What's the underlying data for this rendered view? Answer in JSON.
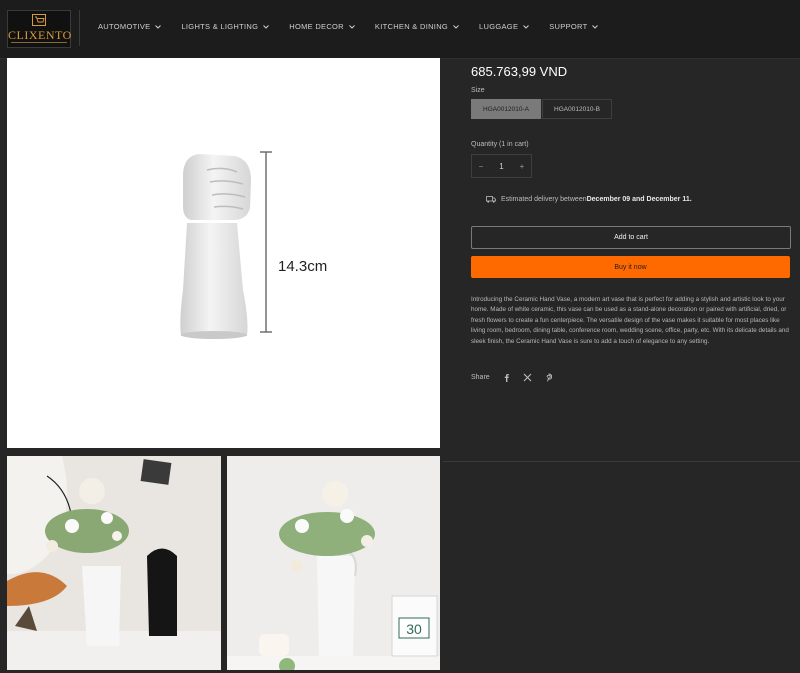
{
  "header": {
    "brand": "CLIXENTO",
    "nav": [
      {
        "label": "AUTOMOTIVE"
      },
      {
        "label": "LIGHTS & LIGHTING"
      },
      {
        "label": "HOME DECOR"
      },
      {
        "label": "KITCHEN & DINING"
      },
      {
        "label": "LUGGAGE"
      },
      {
        "label": "SUPPORT"
      }
    ]
  },
  "gallery": {
    "measurement_label": "14.3cm",
    "calendar_number": "30"
  },
  "product": {
    "price": "685.763,99 VND",
    "size_label": "Size",
    "sizes": [
      {
        "label": "HGA0012010-A",
        "selected": true
      },
      {
        "label": "HGA0012010-B",
        "selected": false
      }
    ],
    "quantity_label": "Quantity (1 in cart)",
    "quantity": "1",
    "qty_minus": "−",
    "qty_plus": "+",
    "delivery_prefix": "Estimated delivery between ",
    "delivery_dates": "December 09 and December 11.",
    "add_to_cart": "Add to cart",
    "buy_now": "Buy it now",
    "description": "Introducing the Ceramic Hand Vase, a modern art vase that is perfect for adding a stylish and artistic look to your home. Made of white ceramic, this vase can be used as a stand-alone decoration or paired with artificial, dried, or fresh flowers to create a fun centerpiece. The versatile design of the vase makes it suitable for most places like living room, bedroom, dining table, conference room, wedding scene, office, party, etc. With its delicate details and sleek finish, the Ceramic Hand Vase is sure to add a touch of elegance to any setting.",
    "share_label": "Share",
    "share_icons": [
      "facebook-icon",
      "x-icon",
      "pinterest-icon"
    ]
  },
  "colors": {
    "accent": "#ff6a00",
    "background": "#262626",
    "header": "#1c1c1c"
  }
}
